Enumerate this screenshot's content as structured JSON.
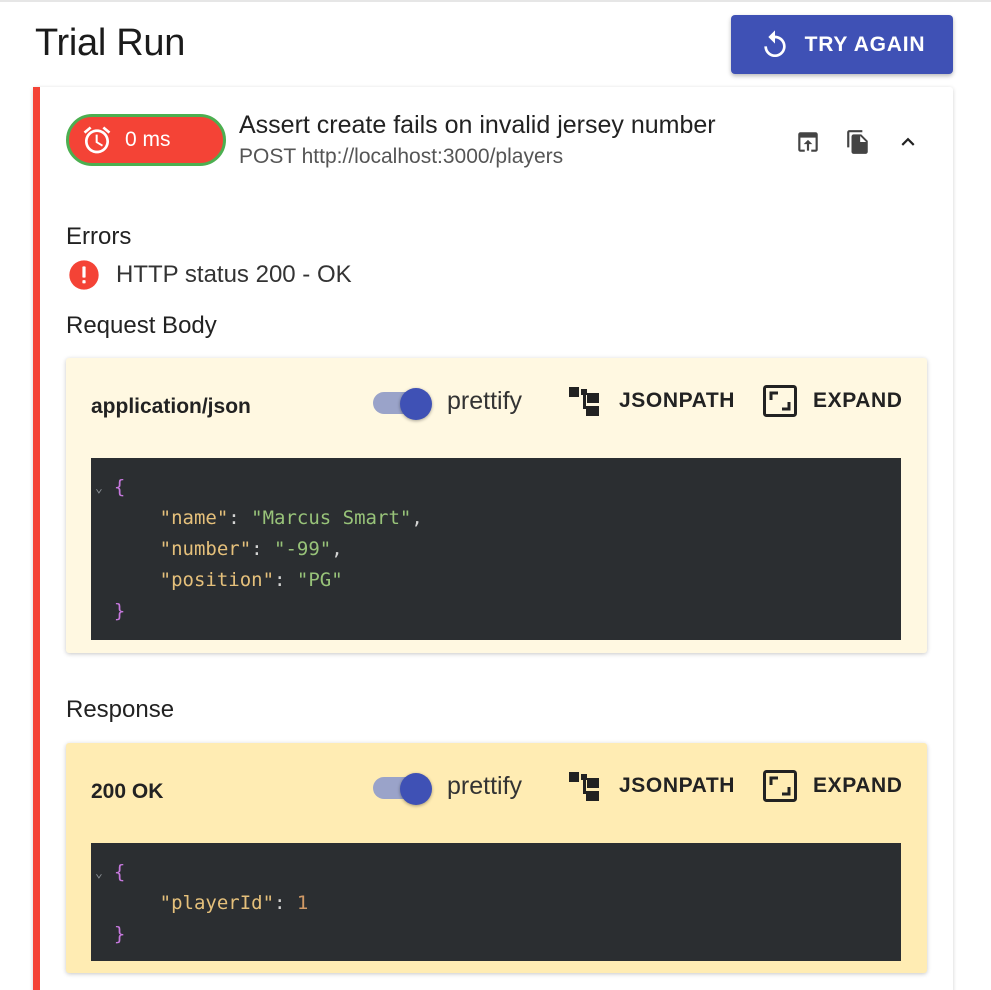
{
  "page": {
    "title": "Trial Run"
  },
  "toolbar": {
    "try_again_label": "TRY AGAIN"
  },
  "test": {
    "duration": "0 ms",
    "name": "Assert create fails on invalid jersey number",
    "request_line": "POST http://localhost:3000/players"
  },
  "errors": {
    "heading": "Errors",
    "items": [
      "HTTP status 200 - OK"
    ]
  },
  "request": {
    "heading": "Request Body",
    "content_type": "application/json",
    "prettify_label": "prettify",
    "jsonpath_label": "JSONPATH",
    "expand_label": "EXPAND",
    "body": {
      "brace_open": "{",
      "brace_close": "}",
      "fields": [
        {
          "key": "\"name\"",
          "value": "\"Marcus Smart\"",
          "value_type": "string",
          "trailing": ","
        },
        {
          "key": "\"number\"",
          "value": "\"-99\"",
          "value_type": "string",
          "trailing": ","
        },
        {
          "key": "\"position\"",
          "value": "\"PG\"",
          "value_type": "string",
          "trailing": ""
        }
      ]
    }
  },
  "response": {
    "heading": "Response",
    "status": "200 OK",
    "prettify_label": "prettify",
    "jsonpath_label": "JSONPATH",
    "expand_label": "EXPAND",
    "body": {
      "brace_open": "{",
      "brace_close": "}",
      "fields": [
        {
          "key": "\"playerId\"",
          "value": "1",
          "value_type": "number",
          "trailing": ""
        }
      ]
    }
  },
  "colors": {
    "primary": "#3f51b5",
    "error": "#f44336",
    "success_border": "#4caf50",
    "request_panel_bg": "#fff8e1",
    "response_panel_bg": "#ffecb3",
    "code_bg": "#2b2e31"
  },
  "icons": {
    "try_again": "refresh-icon",
    "time_chip": "alarm-clock-icon",
    "export": "open-in-icon",
    "copy": "file-copy-icon",
    "collapse": "chevron-up-icon",
    "error": "error-circle-icon",
    "jsonpath": "tree-icon",
    "expand": "fullscreen-frame-icon"
  }
}
